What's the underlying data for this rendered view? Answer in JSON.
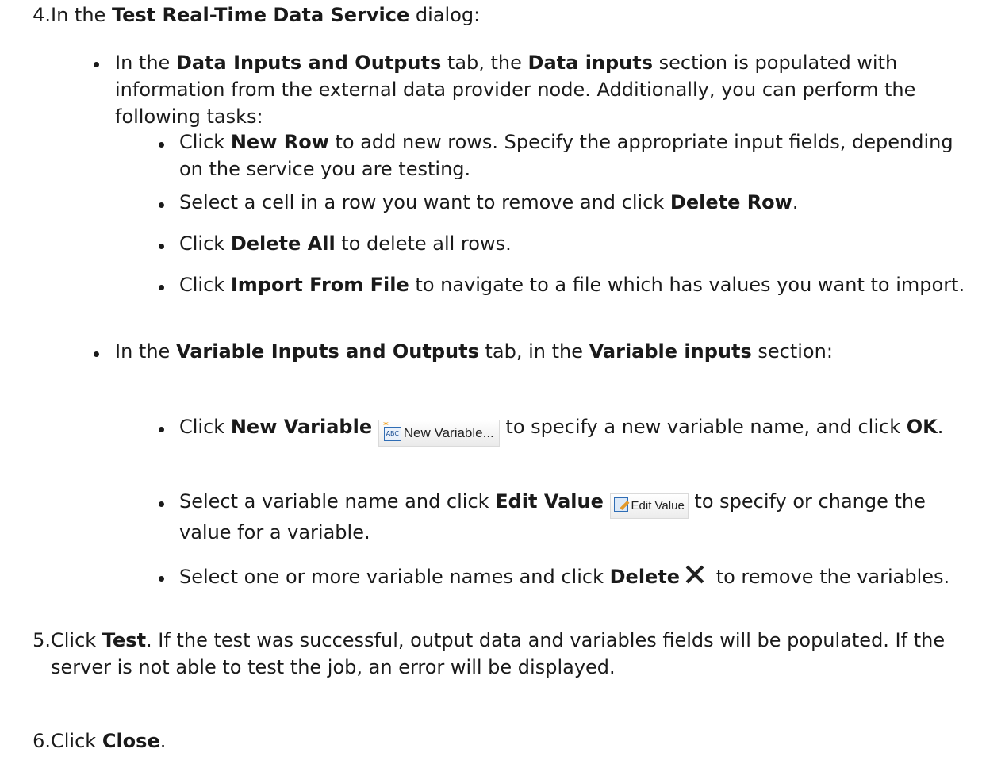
{
  "step4": {
    "num": "4.",
    "pre": "In the ",
    "dialog": "Test Real-Time Data Service",
    "post": " dialog:",
    "data_tab": {
      "t1": "In the ",
      "tab": "Data Inputs and Outputs",
      "t2": " tab, the ",
      "section": "Data inputs",
      "t3": " section is populated with information from the external data provider node. Additionally, you can perform the following tasks:",
      "items": [
        {
          "a": "Click ",
          "b": "New Row",
          "c": " to add new rows. Specify the appropriate input fields, depending on the service you are testing."
        },
        {
          "a": "Select a cell in a row you want to remove and click ",
          "b": "Delete Row",
          "c": "."
        },
        {
          "a": "Click ",
          "b": "Delete All",
          "c": " to delete all rows."
        },
        {
          "a": "Click ",
          "b": "Import From File",
          "c": " to navigate to a file which has values you want to import."
        }
      ]
    },
    "var_tab": {
      "t1": "In the ",
      "tab": "Variable Inputs and Outputs",
      "t2": " tab, in the ",
      "section": "Variable inputs",
      "t3": " section:",
      "new_var": {
        "a": "Click ",
        "b": "New Variable",
        "btn_label": "New Variable...",
        "c": " to specify a new variable name, and click ",
        "d": "OK",
        "e": "."
      },
      "edit_val": {
        "a": "Select a variable name and click ",
        "b": "Edit Value",
        "btn_label": "Edit Value",
        "c": " to specify or change the value for a variable."
      },
      "delete": {
        "a": "Select one or more variable names and click ",
        "b": "Delete",
        "c": " to remove the variables."
      }
    }
  },
  "step5": {
    "num": "5.",
    "a": "Click ",
    "b": "Test",
    "c": ". If the test was successful, output data and variables fields will be populated. If the server is not able to test the job, an error will be displayed."
  },
  "step6": {
    "num": "6.",
    "a": "Click ",
    "b": "Close",
    "c": "."
  },
  "icons": {
    "new_variable": "new-variable-icon",
    "edit_value": "edit-value-icon",
    "delete": "delete-x-icon"
  }
}
